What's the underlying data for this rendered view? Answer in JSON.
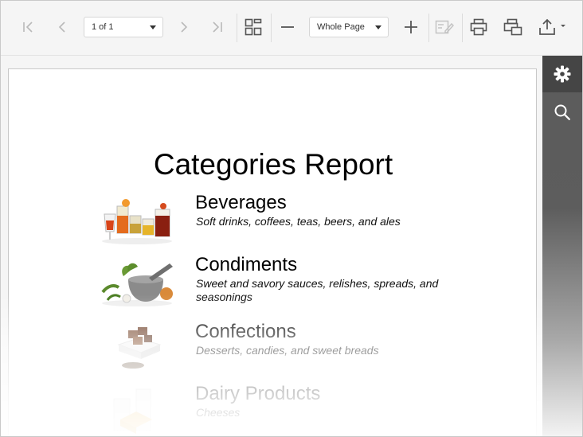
{
  "toolbar": {
    "page_selector": {
      "value": "1 of 1"
    },
    "zoom_selector": {
      "value": "Whole Page"
    },
    "icons": [
      "first-page-icon",
      "previous-page-icon",
      "next-page-icon",
      "last-page-icon",
      "multipage-icon",
      "zoom-out-icon",
      "zoom-in-icon",
      "editing-fields-icon",
      "print-icon",
      "print-page-icon",
      "export-icon"
    ]
  },
  "report": {
    "title": "Categories Report",
    "categories": [
      {
        "name": "Beverages",
        "description": "Soft drinks, coffees, teas, beers, and ales",
        "image_icon": "beverages-image"
      },
      {
        "name": "Condiments",
        "description": "Sweet and savory sauces, relishes, spreads, and seasonings",
        "image_icon": "condiments-image"
      },
      {
        "name": "Confections",
        "description": "Desserts, candies, and sweet breads",
        "image_icon": "confections-image"
      },
      {
        "name": "Dairy Products",
        "description": "Cheeses",
        "image_icon": "dairy-image"
      }
    ]
  },
  "sidepanel": {
    "icons": [
      "gear-icon",
      "search-icon"
    ],
    "colors": {
      "active": "#454545",
      "panel": "#5b5b5b"
    }
  }
}
